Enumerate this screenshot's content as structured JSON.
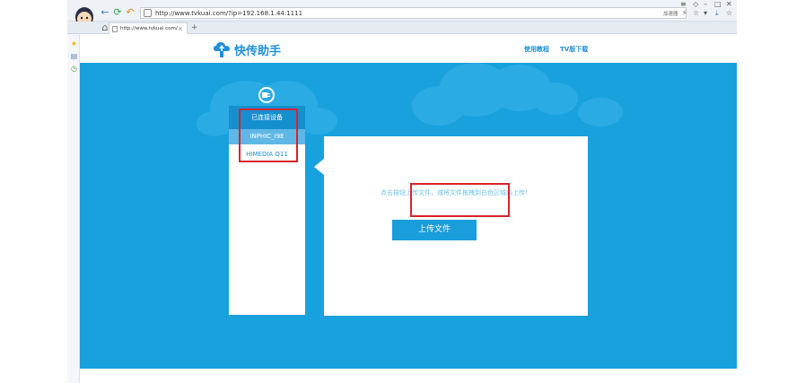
{
  "browser": {
    "url": "http://www.tvkuai.com/?ip=192.168.1.44:1111",
    "accelerator_label": "加速器",
    "tab_title": "http://www.tvkuai.com/",
    "tab_close": "×",
    "tab_add": "+",
    "nav": {
      "back": "←",
      "refresh": "⟳",
      "undo": "↶",
      "home": "⌂"
    }
  },
  "header": {
    "logo_text": "快传助手",
    "links": [
      "使用教程",
      "TV版下载"
    ]
  },
  "devices": {
    "title": "已连接设备",
    "items": [
      {
        "name": "INPHIC_I9E",
        "active": true
      },
      {
        "name": "HIMEDIA Q11",
        "active": false
      }
    ]
  },
  "upload": {
    "hint": "点击按钮上传文件，或将文件拖拽到白色区域内上传！",
    "button_label": "上传文件"
  },
  "colors": {
    "accent": "#19a1de",
    "panel_head": "#1590cf",
    "active_item": "#5fb7e6",
    "highlight": "#d8232a"
  }
}
